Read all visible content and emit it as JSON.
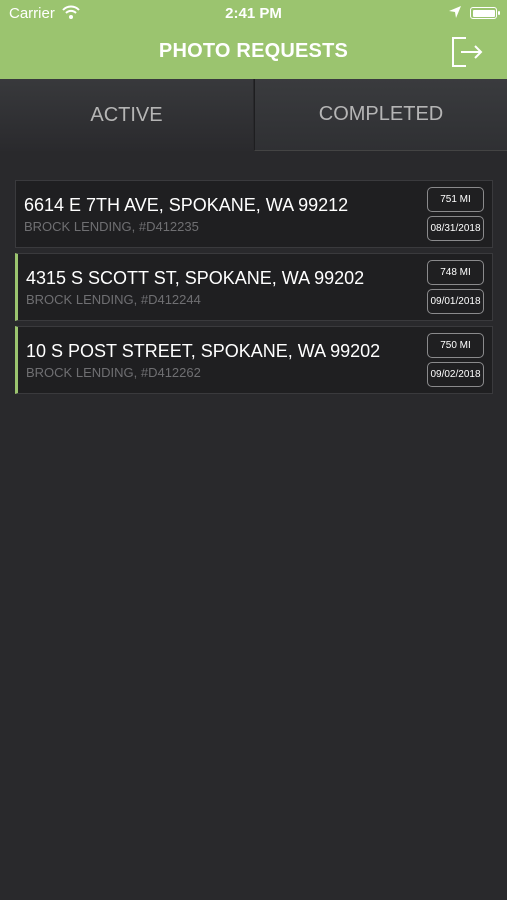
{
  "status_bar": {
    "carrier": "Carrier",
    "time": "2:41 PM"
  },
  "nav": {
    "title": "PHOTO REQUESTS",
    "logout_icon": "logout-icon"
  },
  "tabs": [
    {
      "label": "ACTIVE",
      "selected": true
    },
    {
      "label": "COMPLETED",
      "selected": false
    }
  ],
  "requests": [
    {
      "address": "6614 E 7TH AVE, SPOKANE, WA 99212",
      "client": "BROCK LENDING, #D412235",
      "distance": "751 MI",
      "date": "08/31/2018"
    },
    {
      "address": "4315 S SCOTT ST, SPOKANE, WA 99202",
      "client": "BROCK LENDING, #D412244",
      "distance": "748 MI",
      "date": "09/01/2018"
    },
    {
      "address": "10 S POST STREET, SPOKANE, WA 99202",
      "client": "BROCK LENDING, #D412262",
      "distance": "750 MI",
      "date": "09/02/2018"
    }
  ],
  "colors": {
    "accent": "#9bc46f",
    "background": "#29292c",
    "card": "#1f1f21"
  }
}
